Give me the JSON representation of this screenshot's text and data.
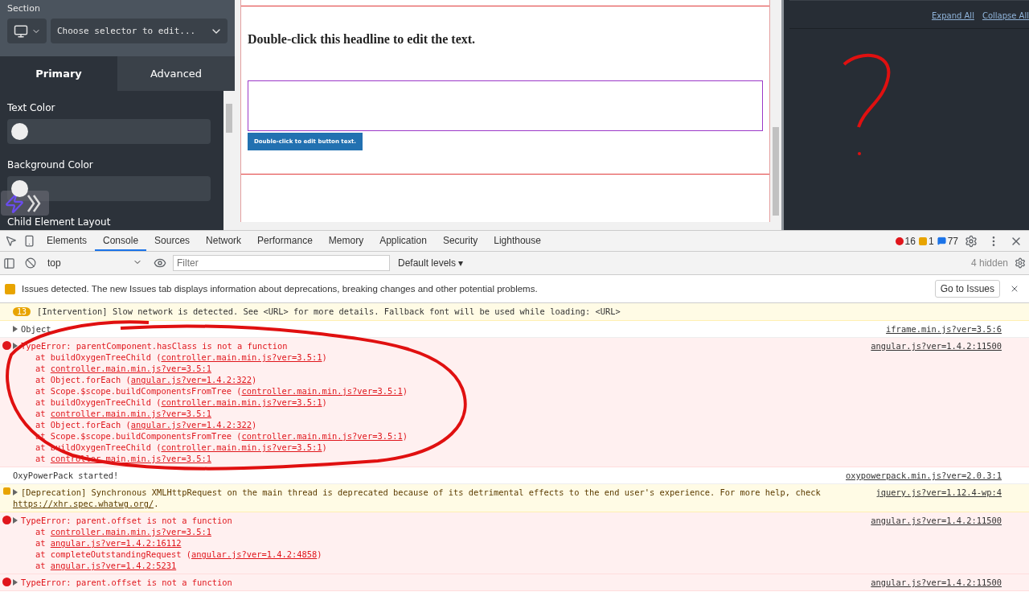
{
  "editor_panel": {
    "section_label": "Section",
    "selector_placeholder": "Choose selector to edit...",
    "tabs": [
      {
        "label": "Primary",
        "selected": true
      },
      {
        "label": "Advanced",
        "selected": false
      }
    ],
    "fields": [
      {
        "label": "Text Color",
        "color": "#eeeeee"
      },
      {
        "label": "Background Color",
        "color": "#eeeeee"
      }
    ],
    "next_label": "Child Element Layout"
  },
  "canvas": {
    "headline": "Double-click this headline to edit the text.",
    "button": "Double-click to edit button text."
  },
  "structure_panel": {
    "links": [
      "Expand All",
      "Collapse All"
    ]
  },
  "devtools": {
    "tabs": [
      {
        "label": "Elements",
        "selected": false
      },
      {
        "label": "Console",
        "selected": true
      },
      {
        "label": "Sources",
        "selected": false
      },
      {
        "label": "Network",
        "selected": false
      },
      {
        "label": "Performance",
        "selected": false
      },
      {
        "label": "Memory",
        "selected": false
      },
      {
        "label": "Application",
        "selected": false
      },
      {
        "label": "Security",
        "selected": false
      },
      {
        "label": "Lighthouse",
        "selected": false
      }
    ],
    "counts": {
      "errors": "16",
      "warnings": "1",
      "messages": "77"
    },
    "context": "top",
    "filter_placeholder": "Filter",
    "levels": "Default levels ▾",
    "hidden": "4 hidden",
    "issues": {
      "text": "Issues detected. The new Issues tab displays information about deprecations, breaking changes and other potential problems.",
      "button": "Go to Issues"
    },
    "messages": [
      {
        "kind": "intervention",
        "badge": "13",
        "text": "[Intervention] Slow network is detected. See <URL> for more details. Fallback font will be used while loading: <URL>"
      },
      {
        "kind": "log",
        "expandable": true,
        "text": "Object",
        "source": "iframe.min.js?ver=3.5:6"
      },
      {
        "kind": "error",
        "expandable": true,
        "text": "TypeError: parentComponent.hasClass is not a function",
        "source": "angular.js?ver=1.4.2:11500",
        "frames": [
          {
            "before": "at buildOxygenTreeChild (",
            "link": "controller.main.min.js?ver=3.5:1",
            "after": ")"
          },
          {
            "before": "at ",
            "link": "controller.main.min.js?ver=3.5:1"
          },
          {
            "before": "at Object.forEach (",
            "link": "angular.js?ver=1.4.2:322",
            "after": ")"
          },
          {
            "before": "at Scope.$scope.buildComponentsFromTree (",
            "link": "controller.main.min.js?ver=3.5:1",
            "after": ")"
          },
          {
            "before": "at buildOxygenTreeChild (",
            "link": "controller.main.min.js?ver=3.5:1",
            "after": ")"
          },
          {
            "before": "at ",
            "link": "controller.main.min.js?ver=3.5:1"
          },
          {
            "before": "at Object.forEach (",
            "link": "angular.js?ver=1.4.2:322",
            "after": ")"
          },
          {
            "before": "at Scope.$scope.buildComponentsFromTree (",
            "link": "controller.main.min.js?ver=3.5:1",
            "after": ")"
          },
          {
            "before": "at buildOxygenTreeChild (",
            "link": "controller.main.min.js?ver=3.5:1",
            "after": ")"
          },
          {
            "before": "at ",
            "link": "controller.main.min.js?ver=3.5:1"
          }
        ]
      },
      {
        "kind": "log",
        "expandable": false,
        "text": "OxyPowerPack started!",
        "source": "oxypowerpack.min.js?ver=2.0.3:1"
      },
      {
        "kind": "warning",
        "expandable": true,
        "text": "[Deprecation] Synchronous XMLHttpRequest on the main thread is deprecated because of its detrimental effects to the end user's experience. For more help, check",
        "source": "jquery.js?ver=1.12.4-wp:4",
        "text_link": "https://xhr.spec.whatwg.org/",
        "text_after": "."
      },
      {
        "kind": "error",
        "expandable": true,
        "text": "TypeError: parent.offset is not a function",
        "source": "angular.js?ver=1.4.2:11500",
        "frames": [
          {
            "before": "at ",
            "link": "controller.main.min.js?ver=3.5:1"
          },
          {
            "before": "at ",
            "link": "angular.js?ver=1.4.2:16112"
          },
          {
            "before": "at completeOutstandingRequest (",
            "link": "angular.js?ver=1.4.2:4858",
            "after": ")"
          },
          {
            "before": "at ",
            "link": "angular.js?ver=1.4.2:5231"
          }
        ]
      },
      {
        "kind": "error",
        "expandable": true,
        "text": "TypeError: parent.offset is not a function",
        "source": "angular.js?ver=1.4.2:11500"
      }
    ]
  }
}
